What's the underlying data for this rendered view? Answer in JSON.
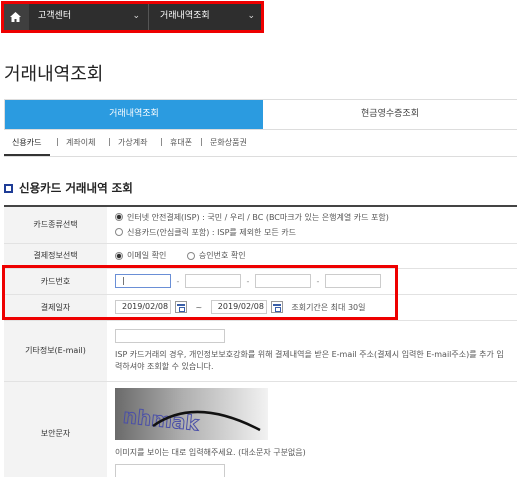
{
  "topnav": {
    "home_icon": "home-icon",
    "menu1": "고객센터",
    "menu2": "거래내역조회"
  },
  "page": {
    "title": "거래내역조회"
  },
  "tabs": [
    {
      "label": "거래내역조회",
      "active": true
    },
    {
      "label": "현금영수증조회",
      "active": false
    }
  ],
  "subtabs": [
    {
      "label": "신용카드",
      "active": true
    },
    {
      "label": "계좌이체"
    },
    {
      "label": "가상계좌"
    },
    {
      "label": "휴대폰"
    },
    {
      "label": "문화상품권"
    }
  ],
  "section": {
    "title": "신용카드 거래내역 조회"
  },
  "form": {
    "card_type": {
      "label": "카드종류선택",
      "option1": "인터넷 안전결제(ISP) : 국민 / 우리 / BC (BC마크가 있는 은행계열 카드 포함)",
      "option2": "신용카드(안심클릭 포함) : ISP를 제외한 모든 카드"
    },
    "payment_info": {
      "label": "결제정보선택",
      "option1": "이메일 확인",
      "option2": "승인번호 확인"
    },
    "card_number": {
      "label": "카드번호",
      "value1": "|"
    },
    "payment_date": {
      "label": "결제일자",
      "from": "2019/02/08",
      "tilde": "~",
      "to": "2019/02/08",
      "note": "조회기간은 최대 30일"
    },
    "extra": {
      "label": "기타정보(E-mail)",
      "desc": "ISP 카드거래의 경우, 개인정보보호강화를 위해 결제내역을 받은 E-mail 주소(결제시 입력한 E-mail주소)를 추가 입력하셔야 조회할 수 있습니다."
    },
    "security": {
      "label": "보안문자",
      "captcha_text": "nhmak",
      "instruction": "이미지를 보이는 대로 입력해주세요. (대소문자 구분없음)"
    },
    "dash": "-"
  },
  "colors": {
    "accent": "#2b9be0",
    "highlight": "#e00000",
    "nav": "#2e2e2e"
  }
}
